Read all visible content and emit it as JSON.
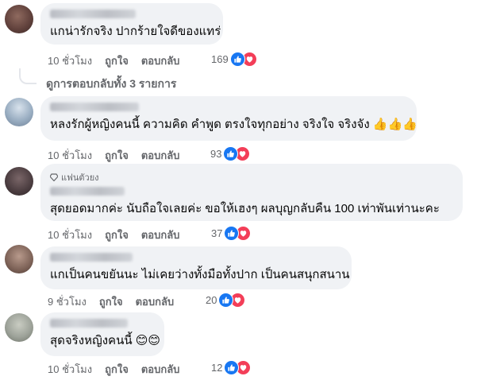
{
  "comments": [
    {
      "badge": "",
      "text": "แกน่ารักจริง ปากร้ายใจดีของแทร่",
      "emojis": "",
      "time": "10 ชั่วโมง",
      "like_label": "ถูกใจ",
      "reply_label": "ตอบกลับ",
      "reaction_count": "169",
      "avatar_color": "#6b4a44"
    },
    {
      "badge": "",
      "text": "หลงรักผู้หญิงคนนี้ ความคิด คำพูด ตรงใจทุกอย่าง จริงใจ จริงจัง",
      "emojis": "👍👍👍",
      "time": "10 ชั่วโมง",
      "like_label": "ถูกใจ",
      "reply_label": "ตอบกลับ",
      "reaction_count": "93",
      "avatar_color": "#a8b8c8"
    },
    {
      "badge": "แฟนตัวยง",
      "text": "สุดยอดมากค่ะ นับถือใจเลยค่ะ ขอให้เฮงๆ ผลบุญกลับคืน 100 เท่าพันเท่านะคะ",
      "emojis": "",
      "time": "10 ชั่วโมง",
      "like_label": "ถูกใจ",
      "reply_label": "ตอบกลับ",
      "reaction_count": "37",
      "avatar_color": "#5a4c4e"
    },
    {
      "badge": "",
      "text": "แกเป็นคนขยันนะ ไม่เคยว่างทั้งมือทั้งปาก เป็นคนสนุกสนาน",
      "emojis": "",
      "time": "9 ชั่วโมง",
      "like_label": "ถูกใจ",
      "reply_label": "ตอบกลับ",
      "reaction_count": "20",
      "avatar_color": "#8a6e63"
    },
    {
      "badge": "",
      "text": "สุดจริงหญิงคนนี้",
      "emojis": "😊😊",
      "time": "10 ชั่วโมง",
      "like_label": "ถูกใจ",
      "reply_label": "ตอบกลับ",
      "reaction_count": "12",
      "avatar_color": "#9ea39a"
    }
  ],
  "view_replies": "ดูการตอบกลับทั้ง 3 รายการ",
  "colors": {
    "bubble_bg": "#f0f2f5",
    "meta_text": "#65676b",
    "like_blue": "#1877f2",
    "love_red": "#f33e58"
  },
  "icons": {
    "like": "thumbs-up-icon",
    "love": "heart-icon",
    "badge": "diamond-icon"
  }
}
